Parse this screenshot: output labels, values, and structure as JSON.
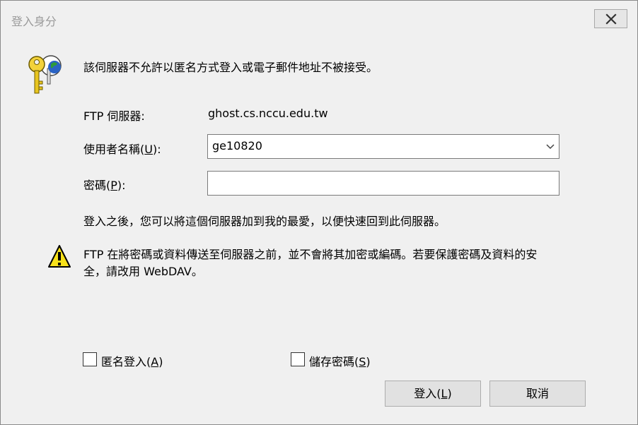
{
  "window": {
    "title": "登入身分"
  },
  "message": "該伺服器不允許以匿名方式登入或電子郵件地址不被接受。",
  "ftp_server": {
    "label": "FTP 伺服器:",
    "value": "ghost.cs.nccu.edu.tw"
  },
  "username": {
    "label_pre": "使用者名稱(",
    "accel": "U",
    "label_post": "):",
    "value": "ge10820"
  },
  "password": {
    "label_pre": "密碼(",
    "accel": "P",
    "label_post": "):",
    "value": ""
  },
  "favorite_note": "登入之後，您可以將這個伺服器加到我的最愛，以便快速回到此伺服器。",
  "warning": {
    "line1": "FTP 在將密碼或資料傳送至伺服器之前，並不會將其加密或編碼。若要保護密碼及資料的安",
    "line2": "全，請改用 WebDAV。"
  },
  "anonymous": {
    "label_pre": "匿名登入(",
    "accel": "A",
    "label_post": ")",
    "checked": false
  },
  "save_password": {
    "label_pre": "儲存密碼(",
    "accel": "S",
    "label_post": ")",
    "checked": false
  },
  "buttons": {
    "login": {
      "label_pre": "登入(",
      "accel": "L",
      "label_post": ")"
    },
    "cancel": {
      "label": "取消"
    }
  },
  "icons": {
    "keys": "keys-globe-icon",
    "warning": "warning-icon",
    "close": "close-icon",
    "dropdown": "chevron-down-icon"
  }
}
